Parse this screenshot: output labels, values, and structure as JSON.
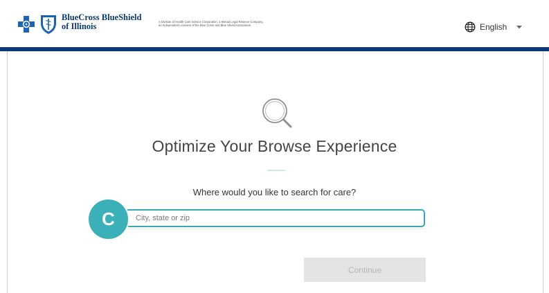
{
  "header": {
    "brand_name_line1": "BlueCross BlueShield",
    "brand_name_line2": "of Illinois",
    "disclaimer_line1": "A Division of Health Care Service Corporation, a Mutual Legal Reserve Company,",
    "disclaimer_line2": "an Independent Licensee of the Blue Cross and Blue Shield Association",
    "language": "English",
    "icons": {
      "cross_logo": "bluecross-logo-icon",
      "shield_logo": "blueshield-logo-icon",
      "language": "globe-icon",
      "dropdown": "chevron-down-icon"
    }
  },
  "main": {
    "icon": "search-icon",
    "title": "Optimize Your Browse Experience",
    "prompt": "Where would you like to search for care?",
    "location_input": {
      "value": "",
      "placeholder": "City, state or zip"
    },
    "step_badge": "C",
    "continue_label": "Continue"
  },
  "colors": {
    "brand_blue": "#0b3a78",
    "accent_teal": "#36a9b3",
    "badge_teal": "#3ab0b8",
    "disabled_button": "#e4e4e4"
  }
}
